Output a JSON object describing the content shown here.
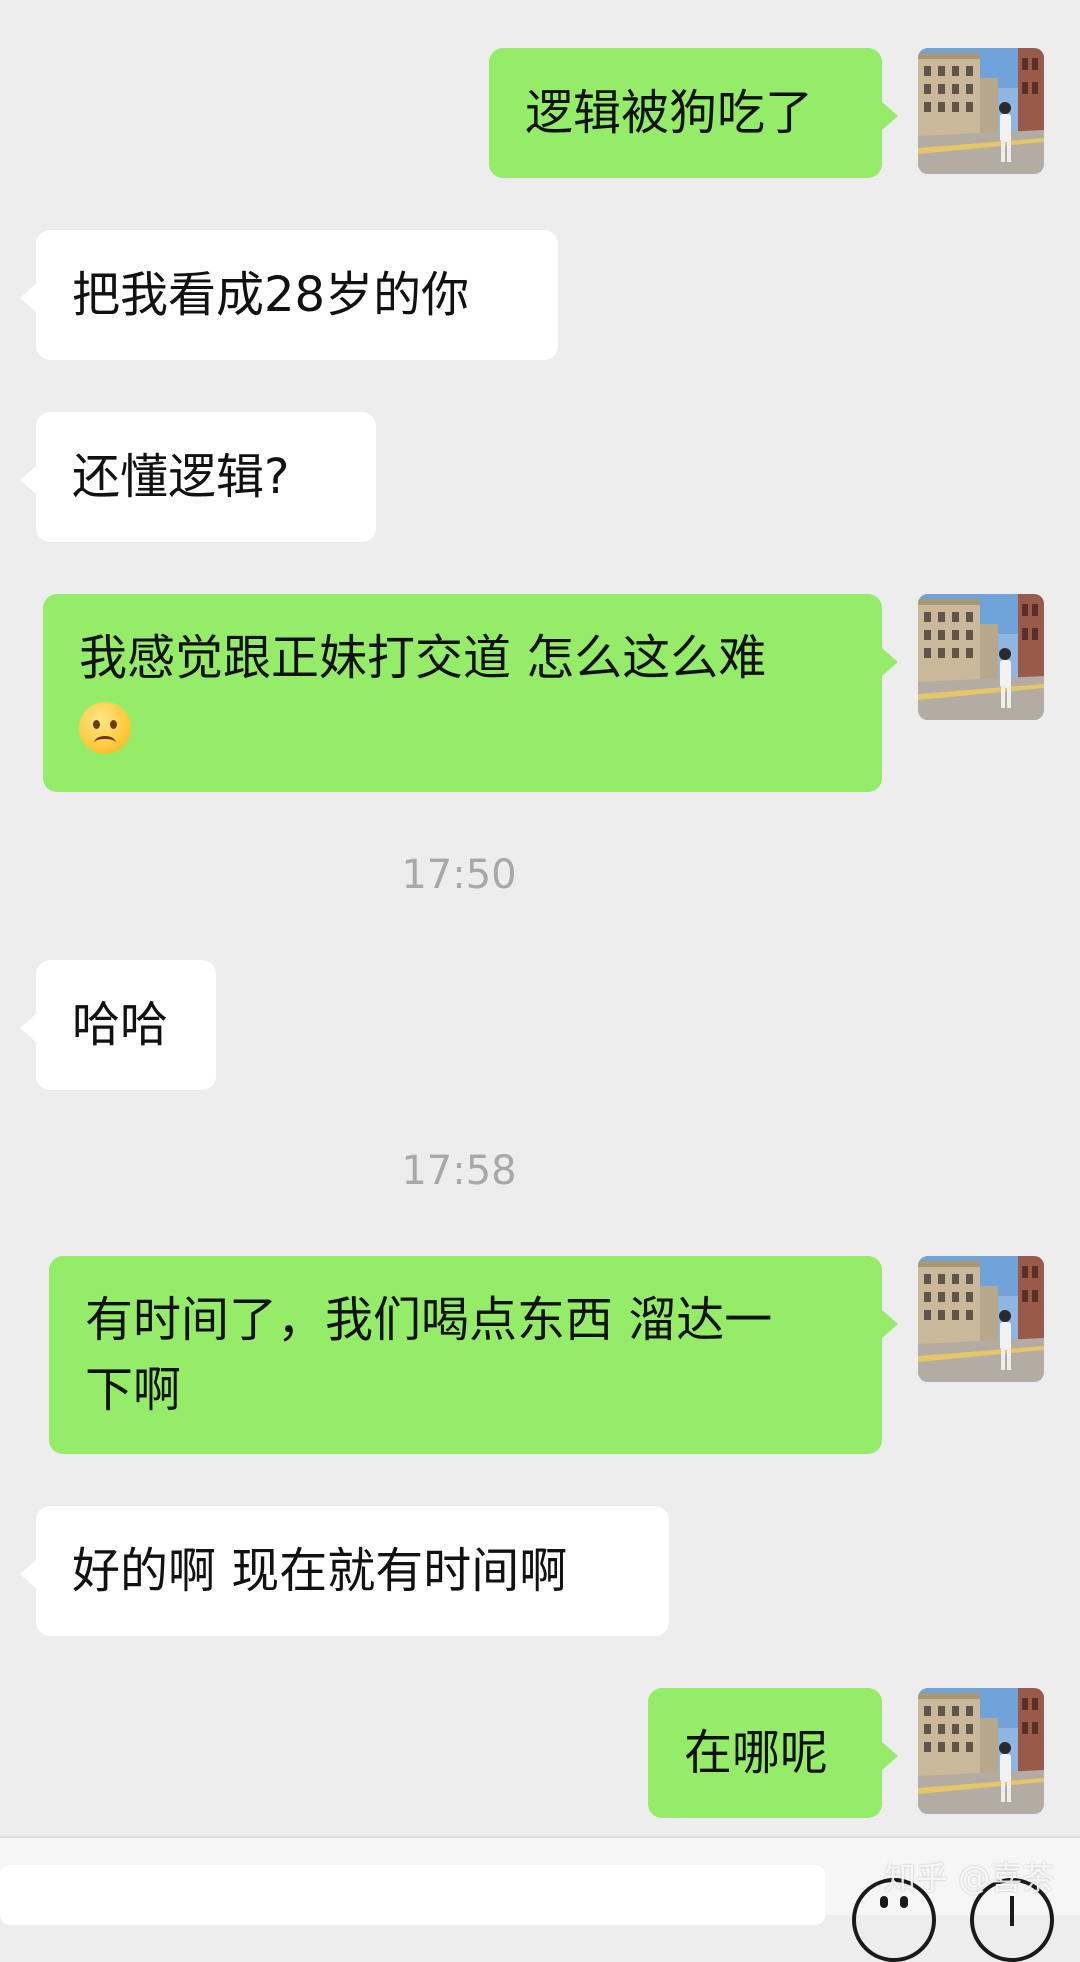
{
  "messages": [
    {
      "side": "out",
      "text": "逻辑被狗吃了"
    },
    {
      "side": "in",
      "text": "把我看成28岁的你"
    },
    {
      "side": "in",
      "text": "还懂逻辑?"
    },
    {
      "side": "out",
      "line1": "我感觉跟正妹打交道  怎么这么难",
      "emoji": "frowning-face-emoji"
    },
    {
      "side": "in",
      "text": "哈哈"
    },
    {
      "side": "out",
      "line1": "有时间了，我们喝点东西  溜达一",
      "line2": "下啊"
    },
    {
      "side": "in",
      "text": "好的啊  现在就有时间啊"
    },
    {
      "side": "out",
      "text": "在哪呢"
    }
  ],
  "timestamps": [
    "17:50",
    "17:58"
  ],
  "colors": {
    "outgoing_bubble": "#95ec69",
    "incoming_bubble": "#ffffff",
    "background": "#ededed"
  },
  "watermark": "知乎 @喜茶",
  "input_bar": {
    "icons": [
      "emoji-icon",
      "plus-icon"
    ]
  }
}
